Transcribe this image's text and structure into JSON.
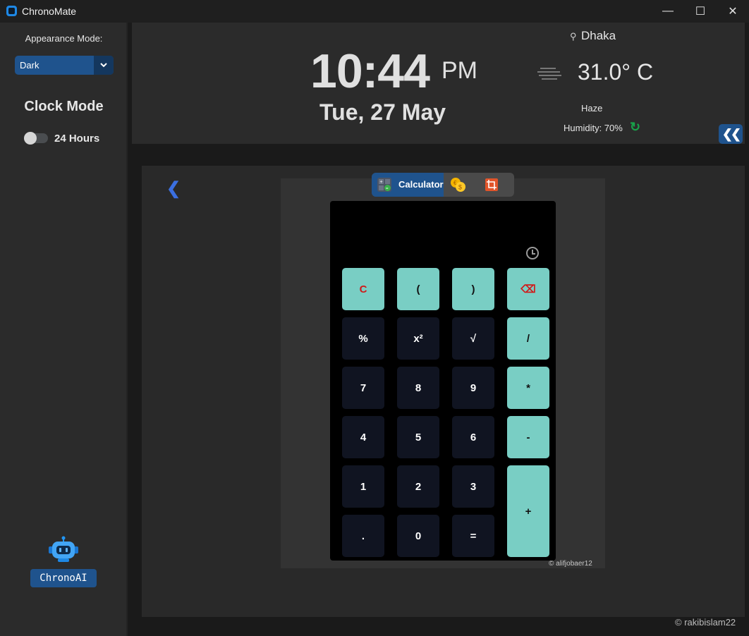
{
  "window": {
    "title": "ChronoMate",
    "minimize": "—",
    "maximize": "☐",
    "close": "✕"
  },
  "sidebar": {
    "appearance_label": "Appearance Mode:",
    "appearance_value": "Dark",
    "clock_mode_title": "Clock Mode",
    "hour_format_label": "24 Hours",
    "hour_format_enabled": false,
    "ai_button": "ChronoAI"
  },
  "clock": {
    "time": "10:44",
    "ampm": "PM",
    "date": "Tue, 27 May"
  },
  "weather": {
    "city": "Dhaka",
    "temperature": "31.0° C",
    "condition": "Haze",
    "humidity": "Humidity: 70%",
    "refresh_icon": "↻",
    "pin_icon": "⚲"
  },
  "nav": {
    "collapse_label": "❮❮",
    "back_label": "❮"
  },
  "tabs": {
    "calculator": "Calculator",
    "currency_icon": "coins-icon",
    "crop_icon": "crop-icon"
  },
  "calculator": {
    "display": "",
    "keys": {
      "clear": "C",
      "open_paren": "(",
      "close_paren": ")",
      "backspace": "⌫",
      "percent": "%",
      "square": "x²",
      "sqrt": "√",
      "divide": "/",
      "seven": "7",
      "eight": "8",
      "nine": "9",
      "multiply": "*",
      "four": "4",
      "five": "5",
      "six": "6",
      "minus": "-",
      "one": "1",
      "two": "2",
      "three": "3",
      "plus": "+",
      "dot": ".",
      "zero": "0",
      "equals": "="
    },
    "credit": "© alifjobaer12"
  },
  "footer_credit": "© rakibislam22",
  "colors": {
    "accent": "#1f538d",
    "teal_key": "#79cec4",
    "dark_key": "#101421",
    "danger": "#d01919"
  }
}
